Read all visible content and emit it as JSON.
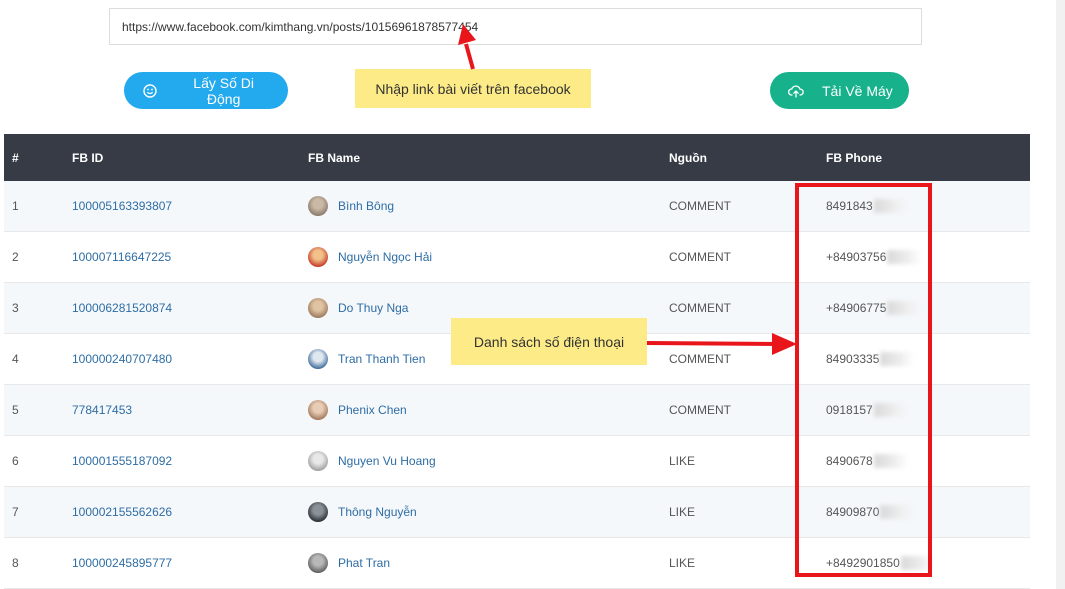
{
  "url_input": {
    "value": "https://www.facebook.com/kimthang.vn/posts/10156961878577454"
  },
  "buttons": {
    "get_phone": "Lấy Số Di Động",
    "download": "Tải Về Máy"
  },
  "annotations": {
    "link_note": "Nhập link bài viết trên facebook",
    "phone_note": "Danh sách số điện thoại"
  },
  "table": {
    "headers": {
      "num": "#",
      "fb_id": "FB ID",
      "fb_name": "FB Name",
      "source": "Nguồn",
      "phone": "FB Phone"
    },
    "rows": [
      {
        "num": "1",
        "fb_id": "100005163393807",
        "name": "Bình Bông",
        "source": "COMMENT",
        "phone": "8491843"
      },
      {
        "num": "2",
        "fb_id": "100007116647225",
        "name": "Nguyễn Ngọc Hải",
        "source": "COMMENT",
        "phone": "+84903756"
      },
      {
        "num": "3",
        "fb_id": "100006281520874",
        "name": "Do Thuy Nga",
        "source": "COMMENT",
        "phone": "+84906775"
      },
      {
        "num": "4",
        "fb_id": "100000240707480",
        "name": "Tran Thanh Tien",
        "source": "COMMENT",
        "phone": "84903335"
      },
      {
        "num": "5",
        "fb_id": "778417453",
        "name": "Phenix Chen",
        "source": "COMMENT",
        "phone": "0918157"
      },
      {
        "num": "6",
        "fb_id": "100001555187092",
        "name": "Nguyen Vu Hoang",
        "source": "LIKE",
        "phone": "8490678"
      },
      {
        "num": "7",
        "fb_id": "100002155562626",
        "name": "Thông Nguyễn",
        "source": "LIKE",
        "phone": "84909870"
      },
      {
        "num": "8",
        "fb_id": "100000245895777",
        "name": "Phat Tran",
        "source": "LIKE",
        "phone": "+8492901850"
      }
    ]
  },
  "colors": {
    "primary_button": "#23a9ee",
    "download_button": "#17b28c",
    "header_bg": "#363b45",
    "highlight_red": "#e8161b",
    "note_bg": "#fdeb87"
  },
  "icons": {
    "get_phone": "smile-icon",
    "download": "cloud-upload-icon"
  }
}
